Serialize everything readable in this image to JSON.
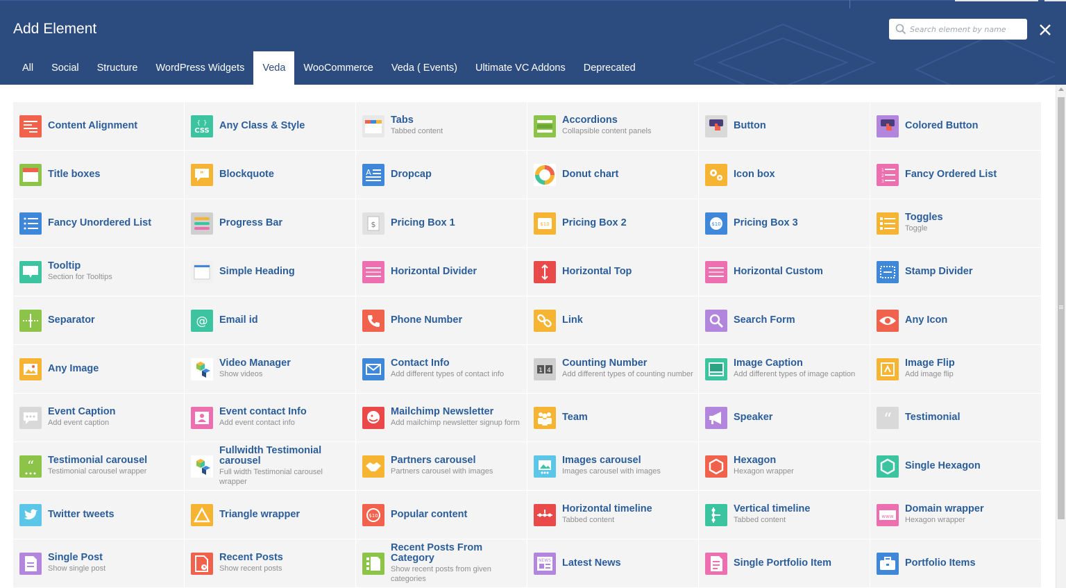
{
  "dialog": {
    "title": "Add Element"
  },
  "search": {
    "placeholder": "Search element by name",
    "icon": "search-icon"
  },
  "close": {
    "icon": "close-icon"
  },
  "tabs": [
    {
      "label": "All"
    },
    {
      "label": "Social"
    },
    {
      "label": "Structure"
    },
    {
      "label": "WordPress Widgets"
    },
    {
      "label": "Veda",
      "active": true
    },
    {
      "label": "WooCommerce"
    },
    {
      "label": "Veda ( Events)"
    },
    {
      "label": "Ultimate VC Addons"
    },
    {
      "label": "Deprecated"
    }
  ],
  "colors": {
    "header": "#2c4c80",
    "active_tab_text": "#2c4c80",
    "element_name": "#2a5d9a",
    "element_desc": "#8f8f8f",
    "cell_bg": "#f4f4f4"
  },
  "elements": [
    {
      "name": "Content Alignment",
      "desc": "",
      "icon": "align-icon",
      "color": "#f0624b"
    },
    {
      "name": "Any Class & Style",
      "desc": "",
      "icon": "css-icon",
      "color": "#3cc4a0"
    },
    {
      "name": "Tabs",
      "desc": "Tabbed content",
      "icon": "tabs-icon",
      "color": "#e8e8e8"
    },
    {
      "name": "Accordions",
      "desc": "Collapsible content panels",
      "icon": "accordion-icon",
      "color": "#8cc449"
    },
    {
      "name": "Button",
      "desc": "",
      "icon": "hand-click-icon",
      "color": "#d9d9d9"
    },
    {
      "name": "Colored Button",
      "desc": "",
      "icon": "hand-click-icon",
      "color": "#b286dc"
    },
    {
      "name": "Title boxes",
      "desc": "",
      "icon": "title-box-icon",
      "color": "#8cc449"
    },
    {
      "name": "Blockquote",
      "desc": "",
      "icon": "quote-bubble-icon",
      "color": "#f5b533"
    },
    {
      "name": "Dropcap",
      "desc": "",
      "icon": "dropcap-icon",
      "color": "#3f88d9"
    },
    {
      "name": "Donut chart",
      "desc": "",
      "icon": "donut-icon",
      "color": "#ffffff"
    },
    {
      "name": "Icon box",
      "desc": "",
      "icon": "gears-icon",
      "color": "#f5b533"
    },
    {
      "name": "Fancy Ordered List",
      "desc": "",
      "icon": "ordered-list-icon",
      "color": "#ee6fb0"
    },
    {
      "name": "Fancy Unordered List",
      "desc": "",
      "icon": "unordered-list-icon",
      "color": "#3f88d9"
    },
    {
      "name": "Progress Bar",
      "desc": "",
      "icon": "progress-bars-icon",
      "color": "#cfcfcf"
    },
    {
      "name": "Pricing Box 1",
      "desc": "",
      "icon": "pricing-dollar-icon",
      "color": "#e1e1e1"
    },
    {
      "name": "Pricing Box 2",
      "desc": "",
      "icon": "price-tag-icon",
      "color": "#f5b533"
    },
    {
      "name": "Pricing Box 3",
      "desc": "",
      "icon": "price-coin-icon",
      "color": "#3f88d9"
    },
    {
      "name": "Toggles",
      "desc": "Toggle",
      "icon": "toggle-list-icon",
      "color": "#f5b533"
    },
    {
      "name": "Tooltip",
      "desc": "Section for Tooltips",
      "icon": "tooltip-icon",
      "color": "#3cc4a0"
    },
    {
      "name": "Simple Heading",
      "desc": "",
      "icon": "heading-icon",
      "color": "#f1f1f1"
    },
    {
      "name": "Horizontal Divider",
      "desc": "",
      "icon": "divider-icon",
      "color": "#ee6fb0"
    },
    {
      "name": "Horizontal Top",
      "desc": "",
      "icon": "arrow-vertical-icon",
      "color": "#ea4949"
    },
    {
      "name": "Horizontal Custom",
      "desc": "",
      "icon": "divider-icon",
      "color": "#ee6fb0"
    },
    {
      "name": "Stamp Divider",
      "desc": "",
      "icon": "stamp-icon",
      "color": "#3f88d9"
    },
    {
      "name": "Separator",
      "desc": "",
      "icon": "separator-icon",
      "color": "#8cc449"
    },
    {
      "name": "Email id",
      "desc": "",
      "icon": "at-icon",
      "color": "#3cc4a0"
    },
    {
      "name": "Phone Number",
      "desc": "",
      "icon": "phone-icon",
      "color": "#f0624b"
    },
    {
      "name": "Link",
      "desc": "",
      "icon": "link-icon",
      "color": "#f5b533"
    },
    {
      "name": "Search Form",
      "desc": "",
      "icon": "magnifier-icon",
      "color": "#b286dc"
    },
    {
      "name": "Any Icon",
      "desc": "",
      "icon": "eye-icon",
      "color": "#f0624b"
    },
    {
      "name": "Any Image",
      "desc": "",
      "icon": "image-icon",
      "color": "#f5b533"
    },
    {
      "name": "Video Manager",
      "desc": "Show videos",
      "icon": "cubes-icon",
      "color": "#ffffff"
    },
    {
      "name": "Contact Info",
      "desc": "Add different types of contact info",
      "icon": "envelope-icon",
      "color": "#3f88d9"
    },
    {
      "name": "Counting Number",
      "desc": "Add different types of counting number",
      "icon": "counter-icon",
      "color": "#cfcfcf"
    },
    {
      "name": "Image Caption",
      "desc": "Add different types of image caption",
      "icon": "image-caption-icon",
      "color": "#3cc4a0"
    },
    {
      "name": "Image Flip",
      "desc": "Add image flip",
      "icon": "image-flip-icon",
      "color": "#f5b533"
    },
    {
      "name": "Event Caption",
      "desc": "Add event caption",
      "icon": "chat-bubble-icon",
      "color": "#d9d9d9"
    },
    {
      "name": "Event contact Info",
      "desc": "Add event contact info",
      "icon": "contact-card-icon",
      "color": "#ee6fb0"
    },
    {
      "name": "Mailchimp Newsletter",
      "desc": "Add mailchimp newsletter signup form",
      "icon": "mailchimp-icon",
      "color": "#ea4949"
    },
    {
      "name": "Team",
      "desc": "",
      "icon": "team-icon",
      "color": "#f5b533"
    },
    {
      "name": "Speaker",
      "desc": "",
      "icon": "megaphone-icon",
      "color": "#b286dc"
    },
    {
      "name": "Testimonial",
      "desc": "",
      "icon": "quote-icon",
      "color": "#d9d9d9"
    },
    {
      "name": "Testimonial carousel",
      "desc": "Testimonial carousel wrapper",
      "icon": "quote-carousel-icon",
      "color": "#8cc449"
    },
    {
      "name": "Fullwidth Testimonial carousel",
      "desc": "Full width Testimonial carousel wrapper",
      "icon": "cubes-icon",
      "color": "#ffffff"
    },
    {
      "name": "Partners carousel",
      "desc": "Partners carousel with images",
      "icon": "handshake-icon",
      "color": "#f5b533"
    },
    {
      "name": "Images carousel",
      "desc": "Images carousel with images",
      "icon": "image-carousel-icon",
      "color": "#5cc6e8"
    },
    {
      "name": "Hexagon",
      "desc": "Hexagon wrapper",
      "icon": "hexagon-icon",
      "color": "#f0624b"
    },
    {
      "name": "Single Hexagon",
      "desc": "",
      "icon": "hexagon-icon",
      "color": "#3cc4a0"
    },
    {
      "name": "Twitter tweets",
      "desc": "",
      "icon": "twitter-icon",
      "color": "#5cc6e8"
    },
    {
      "name": "Triangle wrapper",
      "desc": "",
      "icon": "triangle-icon",
      "color": "#f5b533"
    },
    {
      "name": "Popular content",
      "desc": "",
      "icon": "badge-icon",
      "color": "#f0624b"
    },
    {
      "name": "Horizontal timeline",
      "desc": "Tabbed content",
      "icon": "timeline-horizontal-icon",
      "color": "#ea4949"
    },
    {
      "name": "Vertical timeline",
      "desc": "Tabbed content",
      "icon": "timeline-vertical-icon",
      "color": "#3cc4a0"
    },
    {
      "name": "Domain wrapper",
      "desc": "Hexagon wrapper",
      "icon": "www-icon",
      "color": "#ee6fb0"
    },
    {
      "name": "Single Post",
      "desc": "Show single post",
      "icon": "document-icon",
      "color": "#b286dc"
    },
    {
      "name": "Recent Posts",
      "desc": "Show recent posts",
      "icon": "recent-doc-icon",
      "color": "#f0624b"
    },
    {
      "name": "Recent Posts From Category",
      "desc": "Show recent posts from given categories",
      "icon": "category-doc-icon",
      "color": "#8cc449"
    },
    {
      "name": "Latest News",
      "desc": "",
      "icon": "news-icon",
      "color": "#b286dc"
    },
    {
      "name": "Single Portfolio Item",
      "desc": "",
      "icon": "portfolio-doc-icon",
      "color": "#ee6fb0"
    },
    {
      "name": "Portfolio Items",
      "desc": "",
      "icon": "briefcase-icon",
      "color": "#3f88d9"
    }
  ]
}
